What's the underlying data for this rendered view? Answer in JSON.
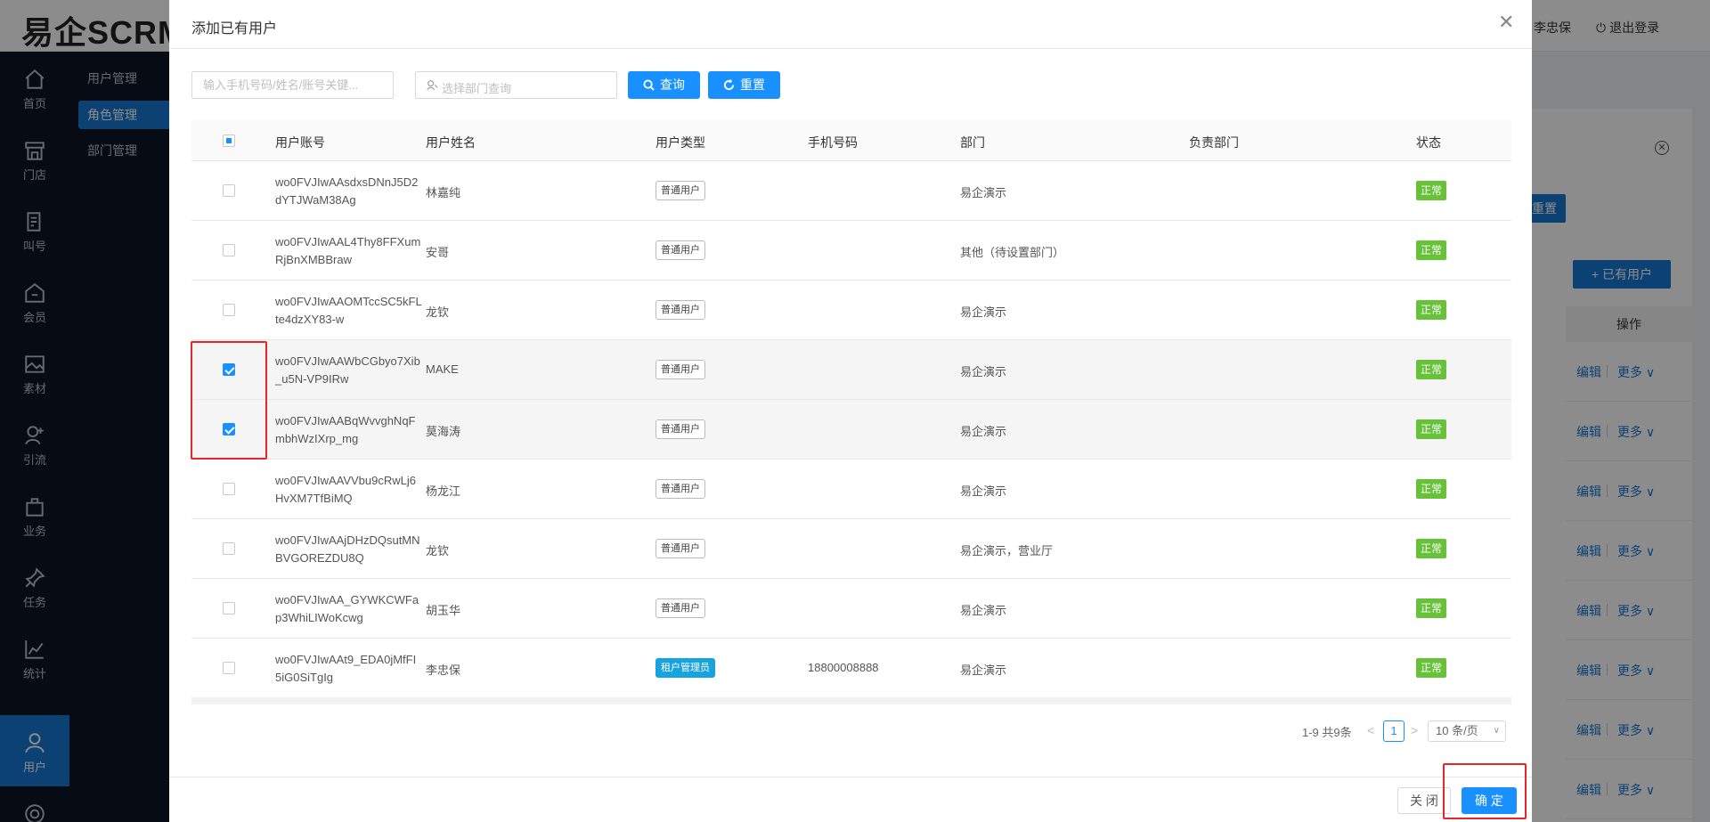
{
  "app": {
    "logo": "易企SCRM",
    "top_user": "李忠保",
    "logout_label": "退出登录"
  },
  "nav": {
    "items": [
      {
        "label": "首页",
        "icon": "home-icon"
      },
      {
        "label": "门店",
        "icon": "store-icon"
      },
      {
        "label": "叫号",
        "icon": "queue-icon"
      },
      {
        "label": "会员",
        "icon": "member-icon"
      },
      {
        "label": "素材",
        "icon": "image-icon"
      },
      {
        "label": "引流",
        "icon": "traffic-icon"
      },
      {
        "label": "业务",
        "icon": "briefcase-icon"
      },
      {
        "label": "任务",
        "icon": "pin-icon"
      },
      {
        "label": "统计",
        "icon": "chart-icon"
      },
      {
        "label": "用户",
        "icon": "user-icon"
      }
    ],
    "active": "用户"
  },
  "subnav": {
    "items": [
      "用户管理",
      "角色管理",
      "部门管理"
    ],
    "active": "角色管理"
  },
  "background": {
    "reset_label": "重置",
    "add_existing_label": "+ 已有用户",
    "ops_header": "操作",
    "edit_label": "编辑",
    "more_label": "更多 ∨"
  },
  "modal": {
    "title": "添加已有用户",
    "search": {
      "placeholder": "输入手机号码/姓名/账号关键..."
    },
    "dept_search": {
      "placeholder": "选择部门查询"
    },
    "query_label": "查询",
    "reset_label": "重置",
    "columns": [
      "用户账号",
      "用户姓名",
      "用户类型",
      "手机号码",
      "部门",
      "负责部门",
      "状态"
    ],
    "rows": [
      {
        "account": "wo0FVJIwAAsdxsDNnJ5D2dYTJWaM38Ag",
        "name": "林嘉纯",
        "type": "普通用户",
        "phone": "",
        "dept": "易企演示",
        "owned_dept": "",
        "status": "正常",
        "checked": false
      },
      {
        "account": "wo0FVJIwAAL4Thy8FFXumRjBnXMBBraw",
        "name": "安哥",
        "type": "普通用户",
        "phone": "",
        "dept": "其他（待设置部门）",
        "owned_dept": "",
        "status": "正常",
        "checked": false
      },
      {
        "account": "wo0FVJIwAAOMTccSC5kFLte4dzXY83-w",
        "name": "龙钦",
        "type": "普通用户",
        "phone": "",
        "dept": "易企演示",
        "owned_dept": "",
        "status": "正常",
        "checked": false
      },
      {
        "account": "wo0FVJIwAAWbCGbyo7Xib_u5N-VP9IRw",
        "name": "MAKE",
        "type": "普通用户",
        "phone": "",
        "dept": "易企演示",
        "owned_dept": "",
        "status": "正常",
        "checked": true
      },
      {
        "account": "wo0FVJIwAABqWvvghNqFmbhWzIXrp_mg",
        "name": "莫海涛",
        "type": "普通用户",
        "phone": "",
        "dept": "易企演示",
        "owned_dept": "",
        "status": "正常",
        "checked": true
      },
      {
        "account": "wo0FVJIwAAVVbu9cRwLj6HvXM7TfBiMQ",
        "name": "杨龙江",
        "type": "普通用户",
        "phone": "",
        "dept": "易企演示",
        "owned_dept": "",
        "status": "正常",
        "checked": false
      },
      {
        "account": "wo0FVJIwAAjDHzDQsutMNBVGOREZDU8Q",
        "name": "龙钦",
        "type": "普通用户",
        "phone": "",
        "dept": "易企演示，营业厅",
        "owned_dept": "",
        "status": "正常",
        "checked": false
      },
      {
        "account": "wo0FVJIwAA_GYWKCWFap3WhiLIWoKcwg",
        "name": "胡玉华",
        "type": "普通用户",
        "phone": "",
        "dept": "易企演示",
        "owned_dept": "",
        "status": "正常",
        "checked": false
      },
      {
        "account": "wo0FVJIwAAt9_EDA0jMfFI5iG0SiTgIg",
        "name": "李忠保",
        "type": "租户管理员",
        "phone": "18800008888",
        "dept": "易企演示",
        "owned_dept": "",
        "status": "正常",
        "checked": false
      }
    ],
    "pagination": {
      "total_text": "1-9 共9条",
      "prev": "<",
      "current_page": "1",
      "next": ">",
      "page_size": "10 条/页"
    },
    "close_label": "关 闭",
    "ok_label": "确 定"
  },
  "colors": {
    "primary": "#1890ff",
    "nav_bg": "#0d1526",
    "status_green": "#67c23a",
    "admin_tag": "#17a2e0",
    "highlight_red": "#e8262a"
  }
}
